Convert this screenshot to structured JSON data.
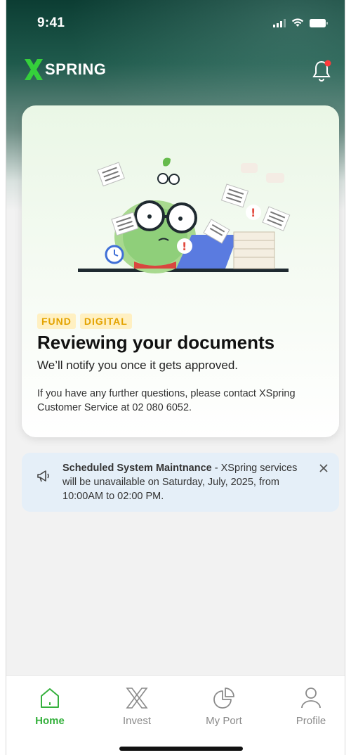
{
  "status_bar": {
    "time": "9:41"
  },
  "brand": {
    "logo_text": "SPRING",
    "accent": "#35d03b"
  },
  "card": {
    "tags": [
      "FUND",
      "DIGITAL"
    ],
    "title": "Reviewing your documents",
    "subtitle": "We’ll notify you once it gets approved.",
    "contact": "If you have any further questions, please contact XSpring Customer Service at 02 080 6052."
  },
  "notice": {
    "title": "Scheduled System Maintnance",
    "separator": " - ",
    "body": "XSpring services will be unavailable on Saturday, July, 2025, from 10:00AM to 02:00 PM."
  },
  "tabbar": {
    "items": [
      {
        "label": "Home",
        "icon": "home-icon",
        "active": true
      },
      {
        "label": "Invest",
        "icon": "invest-icon",
        "active": false
      },
      {
        "label": "My Port",
        "icon": "pie-chart-icon",
        "active": false
      },
      {
        "label": "Profile",
        "icon": "user-icon",
        "active": false
      }
    ]
  },
  "colors": {
    "active": "#35b03d",
    "tag_bg": "#fff0c2",
    "tag_fg": "#e3a300",
    "notice_bg": "#e5eff8"
  }
}
